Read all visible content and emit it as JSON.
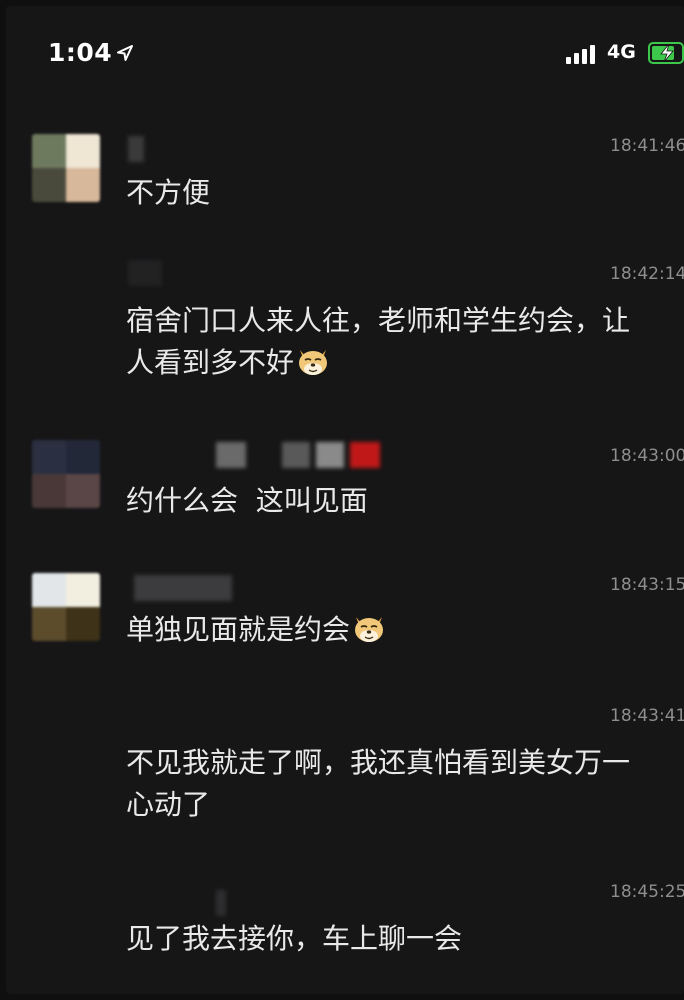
{
  "status_bar": {
    "time": "1:04",
    "network": "4G",
    "icons": [
      "location-arrow-icon",
      "signal-bars-icon",
      "battery-charging-icon"
    ],
    "battery_color": "#3ec84b"
  },
  "messages": [
    {
      "timestamp": "18:41:46",
      "lines": [
        "不方便"
      ],
      "emoji": null
    },
    {
      "timestamp": "18:42:14",
      "lines": [
        "宿舍门口人来人往，老师和学生约会，让",
        "人看到多不好"
      ],
      "emoji": "doge-emoji-icon"
    },
    {
      "timestamp": "18:43:00",
      "lines": [
        "约什么会  这叫见面"
      ],
      "emoji": null
    },
    {
      "timestamp": "18:43:15",
      "lines": [
        "单独见面就是约会"
      ],
      "emoji": "doge-emoji-icon"
    },
    {
      "timestamp": "18:43:41",
      "lines": [
        "不见我就走了啊，我还真怕看到美女万一",
        "心动了"
      ],
      "emoji": null
    },
    {
      "timestamp": "18:45:25",
      "lines": [
        "见了我去接你，车上聊一会"
      ],
      "emoji": null
    }
  ]
}
